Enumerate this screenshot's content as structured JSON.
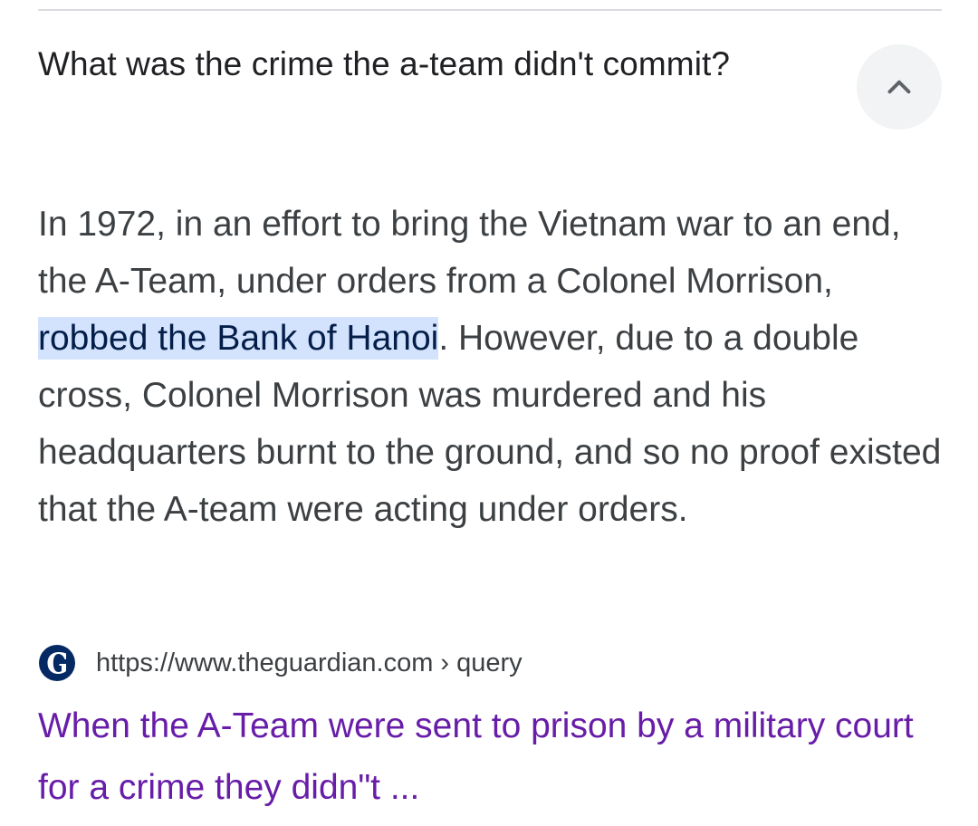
{
  "faq": {
    "question": "What was the crime the a-team didn't commit?",
    "answer_before": "In 1972, in an effort to bring the Vietnam war to an end, the A-Team, under orders from a Colonel Morrison, ",
    "answer_highlight": "robbed the Bank of Hanoi",
    "answer_after": ". However, due to a double cross, Colonel Morrison was murdered and his headquarters burnt to the ground, and so no proof existed that the A-team were acting under orders."
  },
  "source": {
    "url": "https://www.theguardian.com › query",
    "favicon_icon": "guardian-g-logo-icon",
    "title": "When the A-Team were sent to prison by a military court for a crime they didn\"t ..."
  },
  "colors": {
    "highlight_bg": "#d3e3fd",
    "link_visited": "#681da8",
    "button_bg": "#f1f3f4"
  }
}
